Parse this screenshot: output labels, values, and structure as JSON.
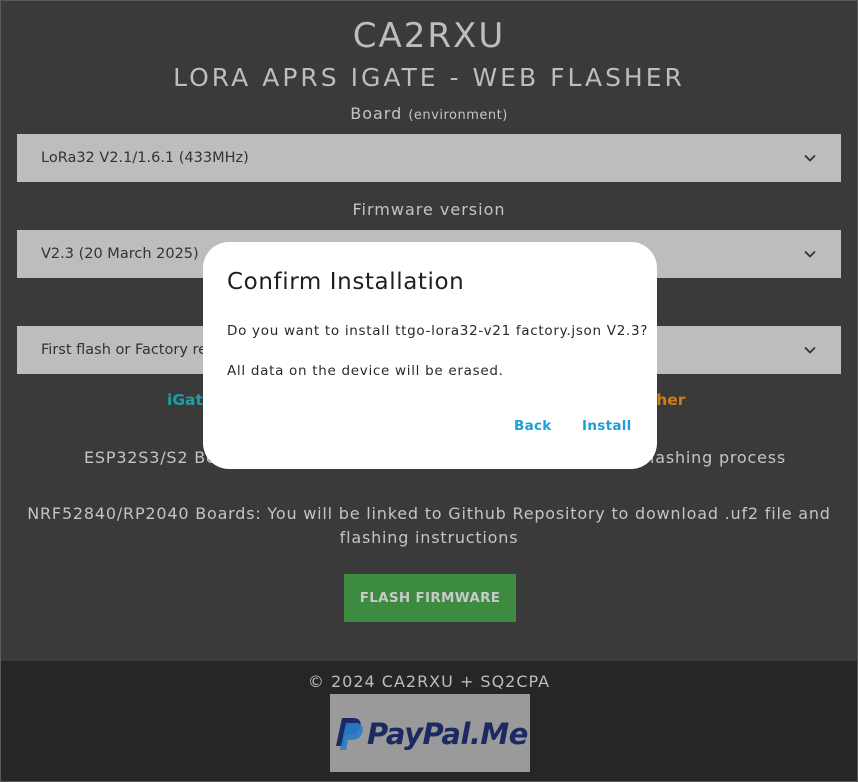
{
  "header": {
    "title": "CA2RXU",
    "subtitle": "LORA APRS IGATE - WEB FLASHER"
  },
  "board": {
    "label": "Board",
    "label_hint": "(environment)",
    "selected": "LoRa32 V2.1/1.6.1 (433MHz)"
  },
  "firmware": {
    "label": "Firmware version",
    "selected": "V2.3 (20 March 2025)"
  },
  "flash_mode": {
    "selected": "First flash or Factory re"
  },
  "links": {
    "left": "iGat",
    "right": "sher"
  },
  "notes": {
    "esp32_left": "ESP32S3/S2 Bo",
    "esp32_right": "lashing process",
    "nrf": "NRF52840/RP2040 Boards: You will be linked to Github Repository to download .uf2 file and flashing instructions"
  },
  "flash_button": {
    "label": "FLASH FIRMWARE",
    "color": "#3d8a41"
  },
  "footer": {
    "copyright": "© 2024 CA2RXU + SQ2CPA",
    "paypal_a": "PayPal",
    "paypal_b": ".Me"
  },
  "dialog": {
    "title": "Confirm Installation",
    "message": "Do you want to install ttgo-lora32-v21 factory.json V2.3?",
    "warning": "All data on the device will be erased.",
    "back_label": "Back",
    "install_label": "Install",
    "button_color": "#1a9fd6"
  },
  "icons": {
    "dropdown": "chevron-down-icon",
    "paypal": "paypal-logo-icon"
  }
}
